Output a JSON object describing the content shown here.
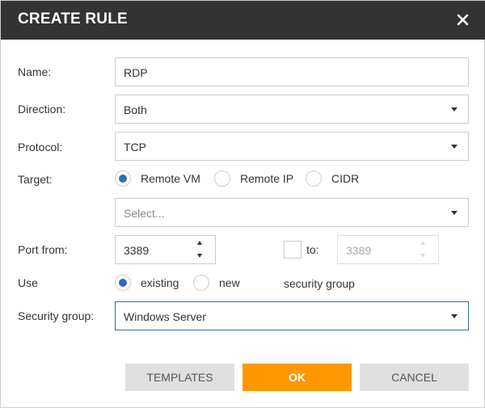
{
  "dialog": {
    "title": "CREATE RULE"
  },
  "form": {
    "name": {
      "label": "Name:",
      "value": "RDP"
    },
    "direction": {
      "label": "Direction:",
      "value": "Both"
    },
    "protocol": {
      "label": "Protocol:",
      "value": "TCP"
    },
    "target": {
      "label": "Target:",
      "options": [
        "Remote VM",
        "Remote IP",
        "CIDR"
      ],
      "selected": "Remote VM",
      "select_placeholder": "Select..."
    },
    "port": {
      "from_label": "Port from:",
      "from_value": "3389",
      "to_label": "to:",
      "to_value": "3389",
      "to_enabled": false
    },
    "use": {
      "label": "Use",
      "options": [
        "existing",
        "new"
      ],
      "selected": "existing",
      "suffix": "security group"
    },
    "security_group": {
      "label": "Security group:",
      "value": "Windows Server"
    }
  },
  "buttons": {
    "templates": "TEMPLATES",
    "ok": "OK",
    "cancel": "CANCEL"
  },
  "colors": {
    "titlebar": "#333333",
    "accent": "#ff9800",
    "radio_selected": "#2e6db4",
    "focus_border": "#3a6d9a"
  }
}
